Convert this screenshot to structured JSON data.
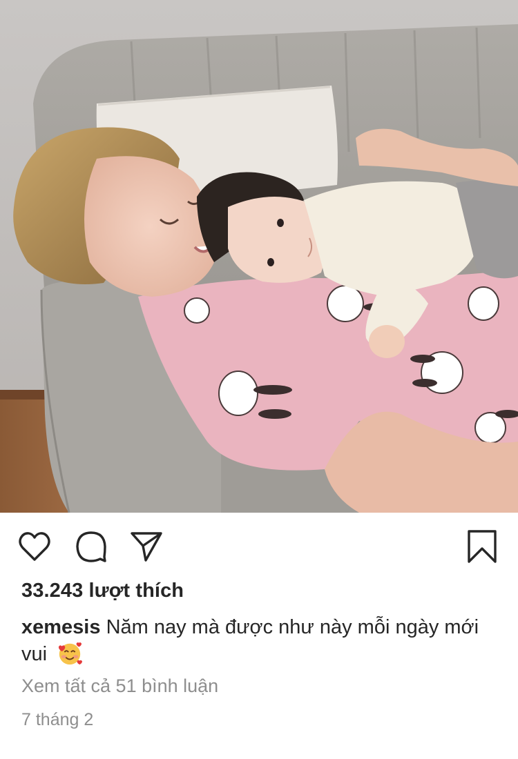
{
  "post": {
    "image_alt": "",
    "likes_text": "33.243 lượt thích",
    "username": "xemesis",
    "caption_text": "Năm nay mà được như này mỗi ngày mới vui",
    "caption_emoji": "smiling-face-with-hearts",
    "view_comments_text": "Xem tất cả 51 bình luận",
    "date_text": "7 tháng 2"
  },
  "icons": {
    "like": "heart-icon",
    "comment": "comment-icon",
    "share": "send-icon",
    "save": "bookmark-icon"
  },
  "colors": {
    "text": "#262626",
    "secondary": "#8e8e8e",
    "background": "#ffffff"
  }
}
